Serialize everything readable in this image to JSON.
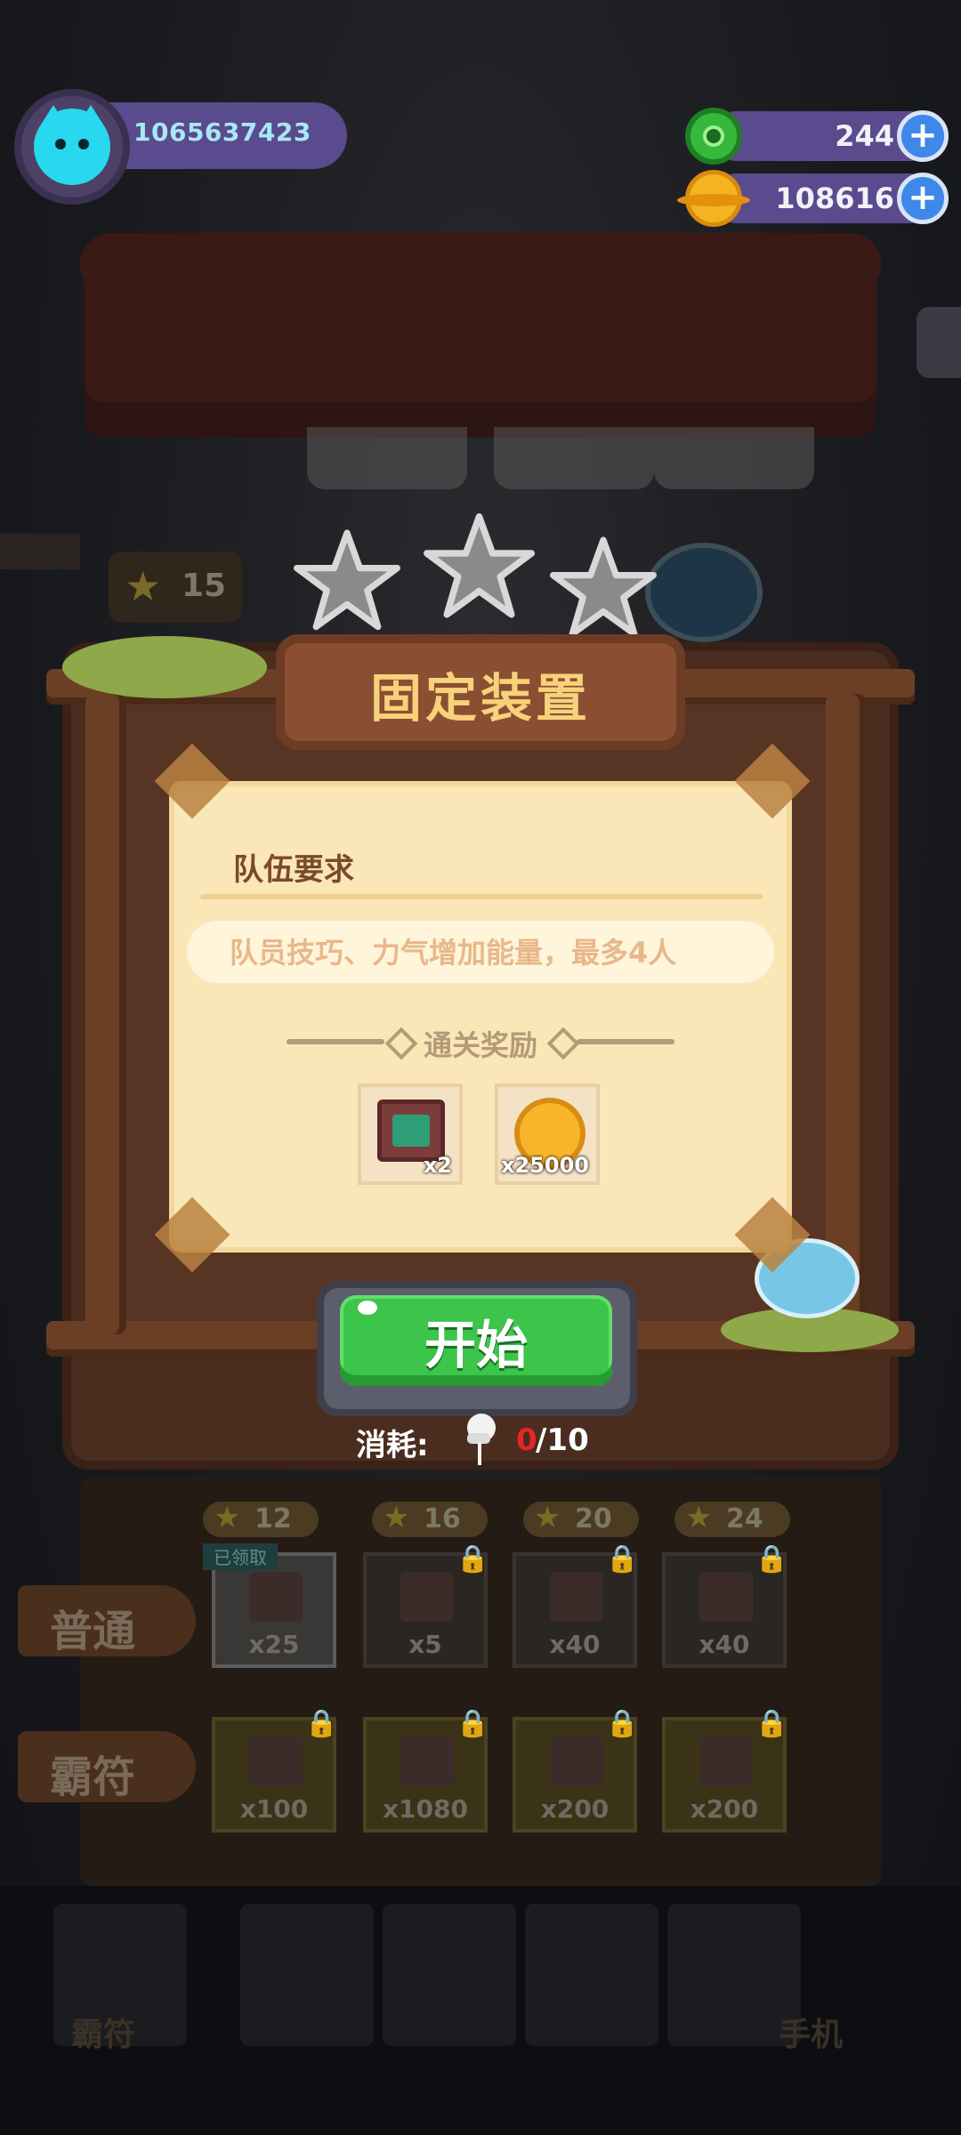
{
  "header": {
    "player_id": "1065637423",
    "gems": "244",
    "coins": "108616"
  },
  "background": {
    "level_stars": "15"
  },
  "dialog": {
    "stars_earned": 0,
    "stars_total": 3,
    "title": "固定装置",
    "requirement_title": "队伍要求",
    "requirement_desc": "队员技巧、力气增加能量，最多4人",
    "rewards_title": "通关奖励",
    "rewards": [
      {
        "icon": "ticket-icon",
        "qty": "x2"
      },
      {
        "icon": "coin-icon",
        "qty": "x25000"
      }
    ],
    "start_label": "开始",
    "consume_label": "消耗:",
    "consume_used": "0",
    "consume_total": "/10"
  },
  "board": {
    "tier_stars": [
      "12",
      "16",
      "20",
      "24"
    ],
    "claimed_tag": "已领取",
    "rows": [
      {
        "label": "普通",
        "slots": [
          "x25",
          "x5",
          "x40",
          "x40"
        ]
      },
      {
        "label": "霸符",
        "slots": [
          "x100",
          "x1080",
          "x200",
          "x200"
        ]
      }
    ]
  },
  "nav": {
    "left_label": "霸符",
    "right_label": "手机"
  },
  "colors": {
    "hud_bar": "#5a4a8e",
    "start_green": "#3cc44b",
    "paper": "#fbe6b8",
    "title_gold": "#f7d27a",
    "consume_red": "#e62626"
  }
}
